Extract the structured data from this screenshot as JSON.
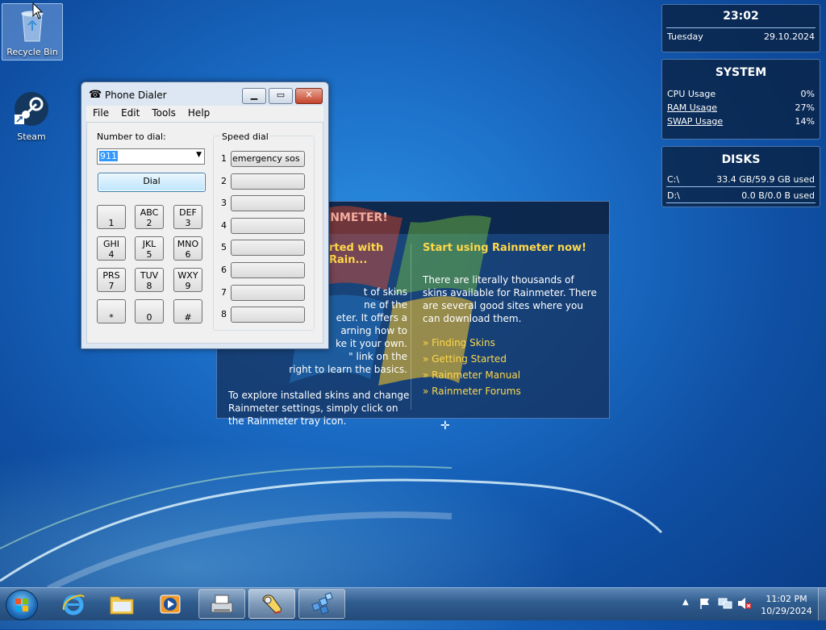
{
  "desktop": {
    "icons": [
      {
        "label": "Recycle Bin"
      },
      {
        "label": "Steam"
      }
    ]
  },
  "rainmeter": {
    "clock": {
      "time": "23:02",
      "day": "Tuesday",
      "date": "29.10.2024"
    },
    "system": {
      "title": "SYSTEM",
      "rows": [
        {
          "label": "CPU Usage",
          "value": "0%"
        },
        {
          "label": "RAM Usage",
          "value": "27%"
        },
        {
          "label": "SWAP Usage",
          "value": "14%"
        }
      ]
    },
    "disks": {
      "title": "DISKS",
      "rows": [
        {
          "label": "C:\\",
          "value": "33.4 GB/59.9 GB used"
        },
        {
          "label": "D:\\",
          "value": "0.0 B/0.0 B used"
        }
      ]
    }
  },
  "welcome": {
    "header": "INMETER!",
    "left": {
      "heading": "rted with Rain...",
      "p1": "t of skins\nne of the\neter. It offers a\narning how to\nke it your own.\n\" link on the\nright to learn the basics.",
      "p2": "To explore installed skins and change Rainmeter settings, simply click on the Rainmeter tray icon."
    },
    "right": {
      "heading": "Start using Rainmeter now!",
      "p1": "There are literally thousands of skins available for Rainmeter. There are several good sites where you can download them.",
      "links": [
        "» Finding Skins",
        "» Getting Started",
        "» Rainmeter Manual",
        "» Rainmeter Forums"
      ]
    }
  },
  "dialer": {
    "title": "Phone Dialer",
    "menu": [
      "File",
      "Edit",
      "Tools",
      "Help"
    ],
    "number_label": "Number to dial:",
    "number_value": "911",
    "dial_label": "Dial",
    "keys": [
      {
        "letters": "",
        "digit": "1"
      },
      {
        "letters": "ABC",
        "digit": "2"
      },
      {
        "letters": "DEF",
        "digit": "3"
      },
      {
        "letters": "GHI",
        "digit": "4"
      },
      {
        "letters": "JKL",
        "digit": "5"
      },
      {
        "letters": "MNO",
        "digit": "6"
      },
      {
        "letters": "PRS",
        "digit": "7"
      },
      {
        "letters": "TUV",
        "digit": "8"
      },
      {
        "letters": "WXY",
        "digit": "9"
      },
      {
        "letters": "",
        "digit": "*"
      },
      {
        "letters": "",
        "digit": "0"
      },
      {
        "letters": "",
        "digit": "#"
      }
    ],
    "speed_dial_label": "Speed dial",
    "speed_dial": [
      {
        "num": "1",
        "name": "emergency sos"
      },
      {
        "num": "2",
        "name": ""
      },
      {
        "num": "3",
        "name": ""
      },
      {
        "num": "4",
        "name": ""
      },
      {
        "num": "5",
        "name": ""
      },
      {
        "num": "6",
        "name": ""
      },
      {
        "num": "7",
        "name": ""
      },
      {
        "num": "8",
        "name": ""
      }
    ]
  },
  "taskbar": {
    "clock_time": "11:02 PM",
    "clock_date": "10/29/2024"
  }
}
